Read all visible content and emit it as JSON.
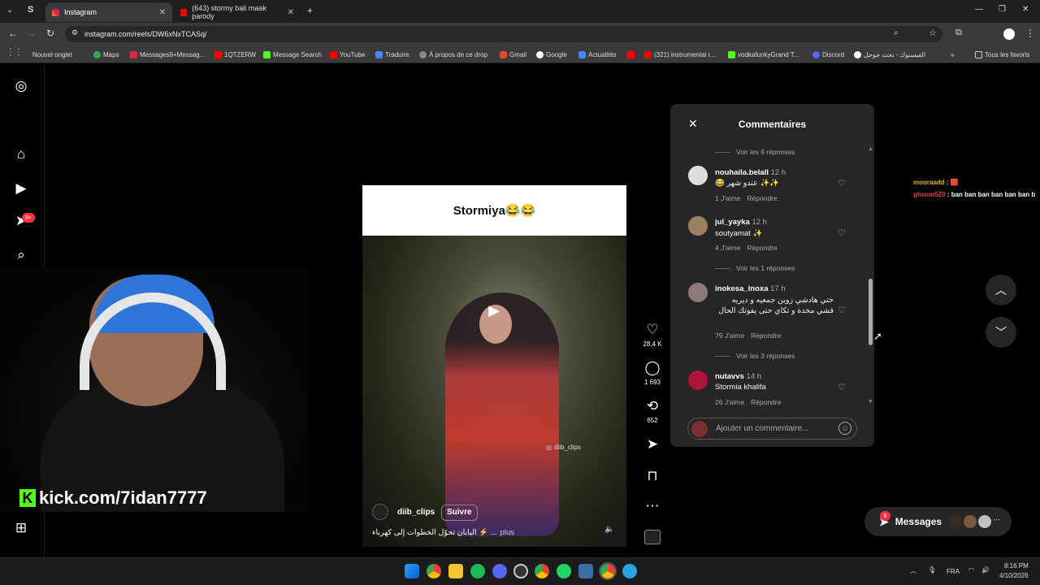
{
  "browser": {
    "tabs": [
      {
        "label": "Instagram",
        "active": true
      },
      {
        "label": "(643) stormy bali maak parody",
        "active": false
      }
    ],
    "url": "instagram.com/reels/DW6xNxTCASq/",
    "bookmarks": [
      "Nouvel onglet",
      "Maps",
      "Messages9+Messag...",
      "1QTZERW",
      "Message Search",
      "YouTube",
      "Traduire",
      "À propos de ce drop",
      "Gmail",
      "Google",
      "Actualités",
      "",
      "(321) instrumental r...",
      "vodkafunkyGrand T...",
      "Discord",
      "الفيسبوك - بحث جوجل"
    ],
    "all_favorites": "Tous les favoris"
  },
  "sidebar": {
    "notification_badge": "9+"
  },
  "reel": {
    "title_text": "Stormiya😂😂",
    "author": "diib_clips",
    "follow_label": "Suivre",
    "caption": "اليابان تحوّل الخطوات إلى كهرباء ⚡ ...",
    "more_label": "plus",
    "watermark": "diib_clips",
    "likes": "28,4 K",
    "comments_count": "1 693",
    "reposts": "652"
  },
  "comments_panel": {
    "title": "Commentaires",
    "top_replies": "Voir les 9 réponses",
    "items": [
      {
        "user": "nouhaila.belall",
        "time": "12 h",
        "text": "😂 عندو شهر ✨✨",
        "likes": "1 J'aime",
        "reply": "Répondre",
        "replies": "Voir les 1 réponses"
      },
      {
        "user": "jul_yayka",
        "time": "12 h",
        "text": "soutyamat ✨",
        "likes": "4 J'aime",
        "reply": "Répondre",
        "replies": ""
      },
      {
        "user": "inokesa_inoxa",
        "time": "17 h",
        "text": "ختي هادشي زوين جمعيه و ديريه فشي مخدة و تكاي حتى يفوتك الحال",
        "likes": "79 J'aime",
        "reply": "Répondre",
        "replies": "Voir les 3 réponses"
      },
      {
        "user": "nutavvs",
        "time": "14 h",
        "text": "Stormia khalifa",
        "likes": "26 J'aime",
        "reply": "Répondre",
        "replies": ""
      }
    ],
    "input_placeholder": "Ajouter un commentaire..."
  },
  "messages": {
    "label": "Messages",
    "badge": "6"
  },
  "stream": {
    "kick_url": "kick.com/7idan7777",
    "chat": [
      {
        "user": "mooraadd",
        "text": "🟥"
      },
      {
        "user": "ghanm520",
        "text": "ban ban ban ban ban ban b"
      }
    ]
  },
  "taskbar": {
    "lang": "FRA",
    "time": "8:16 PM",
    "date": "4/10/2026"
  },
  "colors": {
    "accent_blue": "#0095f6",
    "panel": "#262626",
    "badge_red": "#ff3040",
    "kick_green": "#53fc18"
  }
}
